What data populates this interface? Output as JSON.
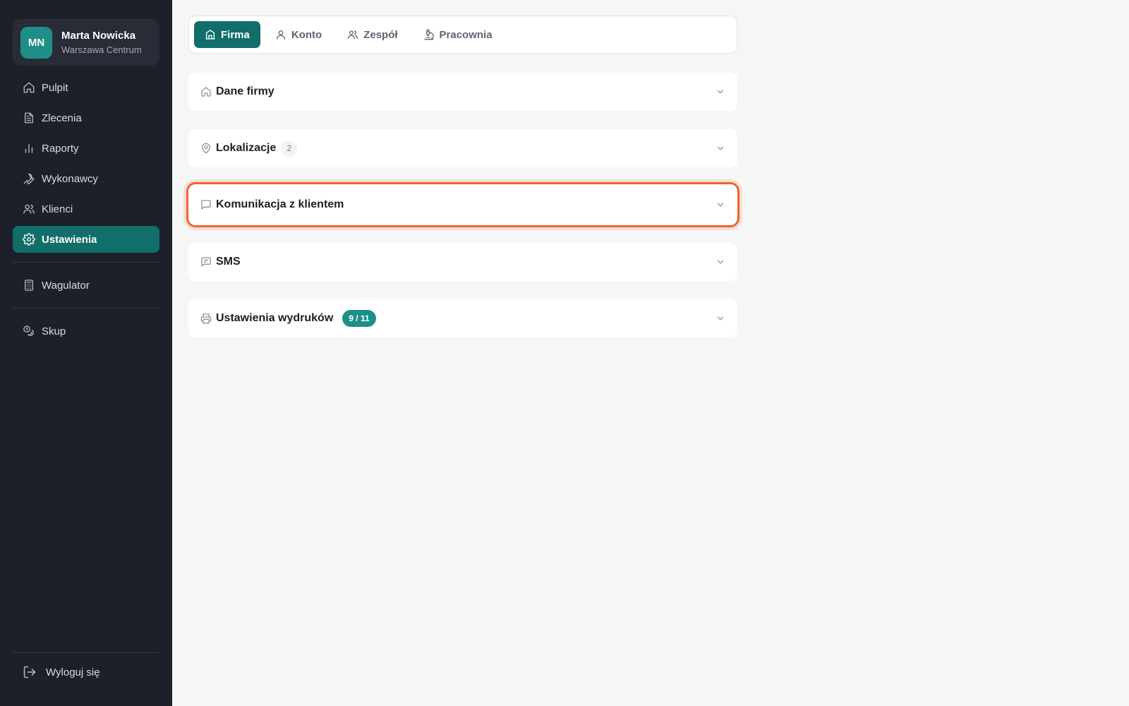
{
  "user": {
    "initials": "MN",
    "name": "Marta Nowicka",
    "location": "Warszawa Centrum"
  },
  "sidebar": {
    "items": [
      {
        "label": "Pulpit",
        "icon": "home-icon",
        "active": false
      },
      {
        "label": "Zlecenia",
        "icon": "file-icon",
        "active": false
      },
      {
        "label": "Raporty",
        "icon": "bar-chart-icon",
        "active": false
      },
      {
        "label": "Wykonawcy",
        "icon": "wrench-icon",
        "active": false
      },
      {
        "label": "Klienci",
        "icon": "users-icon",
        "active": false
      },
      {
        "label": "Ustawienia",
        "icon": "gear-icon",
        "active": true
      }
    ],
    "tools": [
      {
        "label": "Wagulator",
        "icon": "calculator-icon"
      },
      {
        "label": "Skup",
        "icon": "coins-icon"
      }
    ],
    "logout_label": "Wyloguj się"
  },
  "tabs": [
    {
      "label": "Firma",
      "icon": "building-icon",
      "active": true
    },
    {
      "label": "Konto",
      "icon": "user-icon",
      "active": false
    },
    {
      "label": "Zespół",
      "icon": "users-icon",
      "active": false
    },
    {
      "label": "Pracownia",
      "icon": "microscope-icon",
      "active": false
    }
  ],
  "sections": [
    {
      "title": "Dane firmy",
      "icon": "home-icon"
    },
    {
      "title": "Lokalizacje",
      "icon": "map-pin-icon",
      "count": "2"
    },
    {
      "title": "Komunikacja z klientem",
      "icon": "message-square-icon",
      "focused": true
    },
    {
      "title": "SMS",
      "icon": "message-text-icon"
    },
    {
      "title": "Ustawienia wydruków",
      "icon": "printer-icon",
      "progress": "9 / 11"
    }
  ],
  "colors": {
    "sidebar_bg": "#1d2029",
    "accent": "#116e69",
    "avatar": "#1e8f88",
    "focus_ring": "#f0622d"
  }
}
